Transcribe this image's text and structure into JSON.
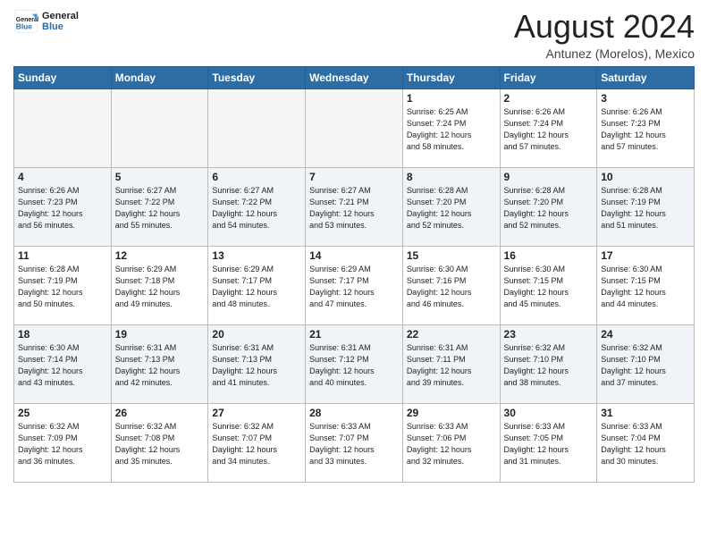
{
  "header": {
    "logo_line1": "General",
    "logo_line2": "Blue",
    "month_year": "August 2024",
    "location": "Antunez (Morelos), Mexico"
  },
  "weekdays": [
    "Sunday",
    "Monday",
    "Tuesday",
    "Wednesday",
    "Thursday",
    "Friday",
    "Saturday"
  ],
  "weeks": [
    [
      {
        "day": "",
        "empty": true,
        "info": ""
      },
      {
        "day": "",
        "empty": true,
        "info": ""
      },
      {
        "day": "",
        "empty": true,
        "info": ""
      },
      {
        "day": "",
        "empty": true,
        "info": ""
      },
      {
        "day": "1",
        "empty": false,
        "info": "Sunrise: 6:25 AM\nSunset: 7:24 PM\nDaylight: 12 hours\nand 58 minutes."
      },
      {
        "day": "2",
        "empty": false,
        "info": "Sunrise: 6:26 AM\nSunset: 7:24 PM\nDaylight: 12 hours\nand 57 minutes."
      },
      {
        "day": "3",
        "empty": false,
        "info": "Sunrise: 6:26 AM\nSunset: 7:23 PM\nDaylight: 12 hours\nand 57 minutes."
      }
    ],
    [
      {
        "day": "4",
        "empty": false,
        "info": "Sunrise: 6:26 AM\nSunset: 7:23 PM\nDaylight: 12 hours\nand 56 minutes."
      },
      {
        "day": "5",
        "empty": false,
        "info": "Sunrise: 6:27 AM\nSunset: 7:22 PM\nDaylight: 12 hours\nand 55 minutes."
      },
      {
        "day": "6",
        "empty": false,
        "info": "Sunrise: 6:27 AM\nSunset: 7:22 PM\nDaylight: 12 hours\nand 54 minutes."
      },
      {
        "day": "7",
        "empty": false,
        "info": "Sunrise: 6:27 AM\nSunset: 7:21 PM\nDaylight: 12 hours\nand 53 minutes."
      },
      {
        "day": "8",
        "empty": false,
        "info": "Sunrise: 6:28 AM\nSunset: 7:20 PM\nDaylight: 12 hours\nand 52 minutes."
      },
      {
        "day": "9",
        "empty": false,
        "info": "Sunrise: 6:28 AM\nSunset: 7:20 PM\nDaylight: 12 hours\nand 52 minutes."
      },
      {
        "day": "10",
        "empty": false,
        "info": "Sunrise: 6:28 AM\nSunset: 7:19 PM\nDaylight: 12 hours\nand 51 minutes."
      }
    ],
    [
      {
        "day": "11",
        "empty": false,
        "info": "Sunrise: 6:28 AM\nSunset: 7:19 PM\nDaylight: 12 hours\nand 50 minutes."
      },
      {
        "day": "12",
        "empty": false,
        "info": "Sunrise: 6:29 AM\nSunset: 7:18 PM\nDaylight: 12 hours\nand 49 minutes."
      },
      {
        "day": "13",
        "empty": false,
        "info": "Sunrise: 6:29 AM\nSunset: 7:17 PM\nDaylight: 12 hours\nand 48 minutes."
      },
      {
        "day": "14",
        "empty": false,
        "info": "Sunrise: 6:29 AM\nSunset: 7:17 PM\nDaylight: 12 hours\nand 47 minutes."
      },
      {
        "day": "15",
        "empty": false,
        "info": "Sunrise: 6:30 AM\nSunset: 7:16 PM\nDaylight: 12 hours\nand 46 minutes."
      },
      {
        "day": "16",
        "empty": false,
        "info": "Sunrise: 6:30 AM\nSunset: 7:15 PM\nDaylight: 12 hours\nand 45 minutes."
      },
      {
        "day": "17",
        "empty": false,
        "info": "Sunrise: 6:30 AM\nSunset: 7:15 PM\nDaylight: 12 hours\nand 44 minutes."
      }
    ],
    [
      {
        "day": "18",
        "empty": false,
        "info": "Sunrise: 6:30 AM\nSunset: 7:14 PM\nDaylight: 12 hours\nand 43 minutes."
      },
      {
        "day": "19",
        "empty": false,
        "info": "Sunrise: 6:31 AM\nSunset: 7:13 PM\nDaylight: 12 hours\nand 42 minutes."
      },
      {
        "day": "20",
        "empty": false,
        "info": "Sunrise: 6:31 AM\nSunset: 7:13 PM\nDaylight: 12 hours\nand 41 minutes."
      },
      {
        "day": "21",
        "empty": false,
        "info": "Sunrise: 6:31 AM\nSunset: 7:12 PM\nDaylight: 12 hours\nand 40 minutes."
      },
      {
        "day": "22",
        "empty": false,
        "info": "Sunrise: 6:31 AM\nSunset: 7:11 PM\nDaylight: 12 hours\nand 39 minutes."
      },
      {
        "day": "23",
        "empty": false,
        "info": "Sunrise: 6:32 AM\nSunset: 7:10 PM\nDaylight: 12 hours\nand 38 minutes."
      },
      {
        "day": "24",
        "empty": false,
        "info": "Sunrise: 6:32 AM\nSunset: 7:10 PM\nDaylight: 12 hours\nand 37 minutes."
      }
    ],
    [
      {
        "day": "25",
        "empty": false,
        "info": "Sunrise: 6:32 AM\nSunset: 7:09 PM\nDaylight: 12 hours\nand 36 minutes."
      },
      {
        "day": "26",
        "empty": false,
        "info": "Sunrise: 6:32 AM\nSunset: 7:08 PM\nDaylight: 12 hours\nand 35 minutes."
      },
      {
        "day": "27",
        "empty": false,
        "info": "Sunrise: 6:32 AM\nSunset: 7:07 PM\nDaylight: 12 hours\nand 34 minutes."
      },
      {
        "day": "28",
        "empty": false,
        "info": "Sunrise: 6:33 AM\nSunset: 7:07 PM\nDaylight: 12 hours\nand 33 minutes."
      },
      {
        "day": "29",
        "empty": false,
        "info": "Sunrise: 6:33 AM\nSunset: 7:06 PM\nDaylight: 12 hours\nand 32 minutes."
      },
      {
        "day": "30",
        "empty": false,
        "info": "Sunrise: 6:33 AM\nSunset: 7:05 PM\nDaylight: 12 hours\nand 31 minutes."
      },
      {
        "day": "31",
        "empty": false,
        "info": "Sunrise: 6:33 AM\nSunset: 7:04 PM\nDaylight: 12 hours\nand 30 minutes."
      }
    ]
  ]
}
